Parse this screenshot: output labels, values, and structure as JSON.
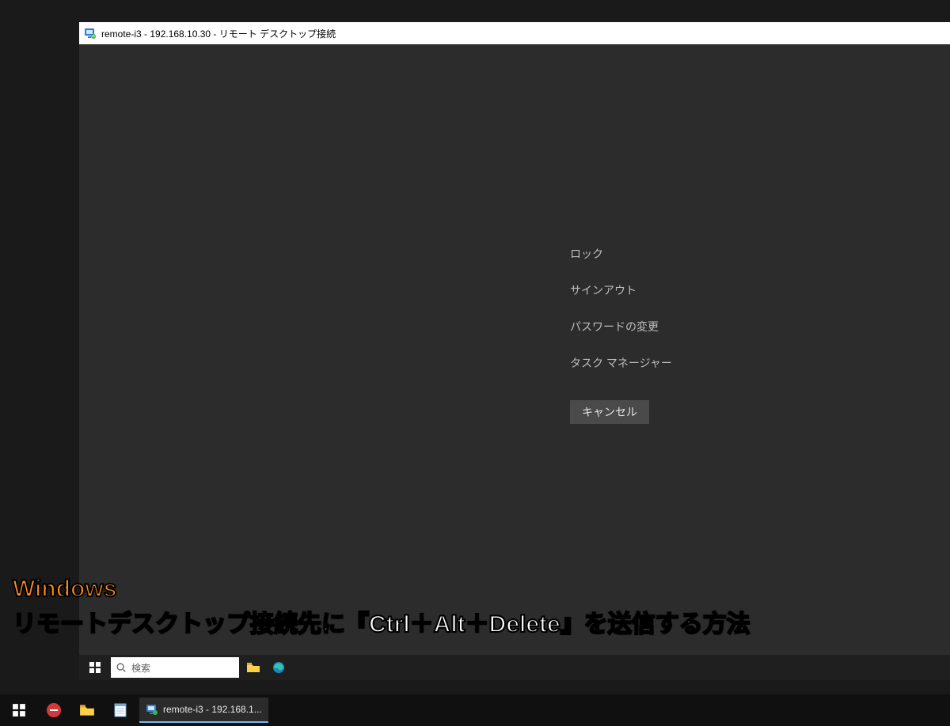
{
  "rdp": {
    "title": "remote-i3 - 192.168.10.30 - リモート デスクトップ接続"
  },
  "cad": {
    "lock": "ロック",
    "signout": "サインアウト",
    "change_password": "パスワードの変更",
    "task_manager": "タスク マネージャー",
    "cancel": "キャンセル"
  },
  "remote_taskbar": {
    "search_placeholder": "検索"
  },
  "caption": {
    "line1": "Windows",
    "line2": "リモートデスクトップ接続先に『Ctrl＋Alt＋Delete』を送信する方法"
  },
  "host_taskbar": {
    "task_label": "remote-i3 - 192.168.1..."
  }
}
